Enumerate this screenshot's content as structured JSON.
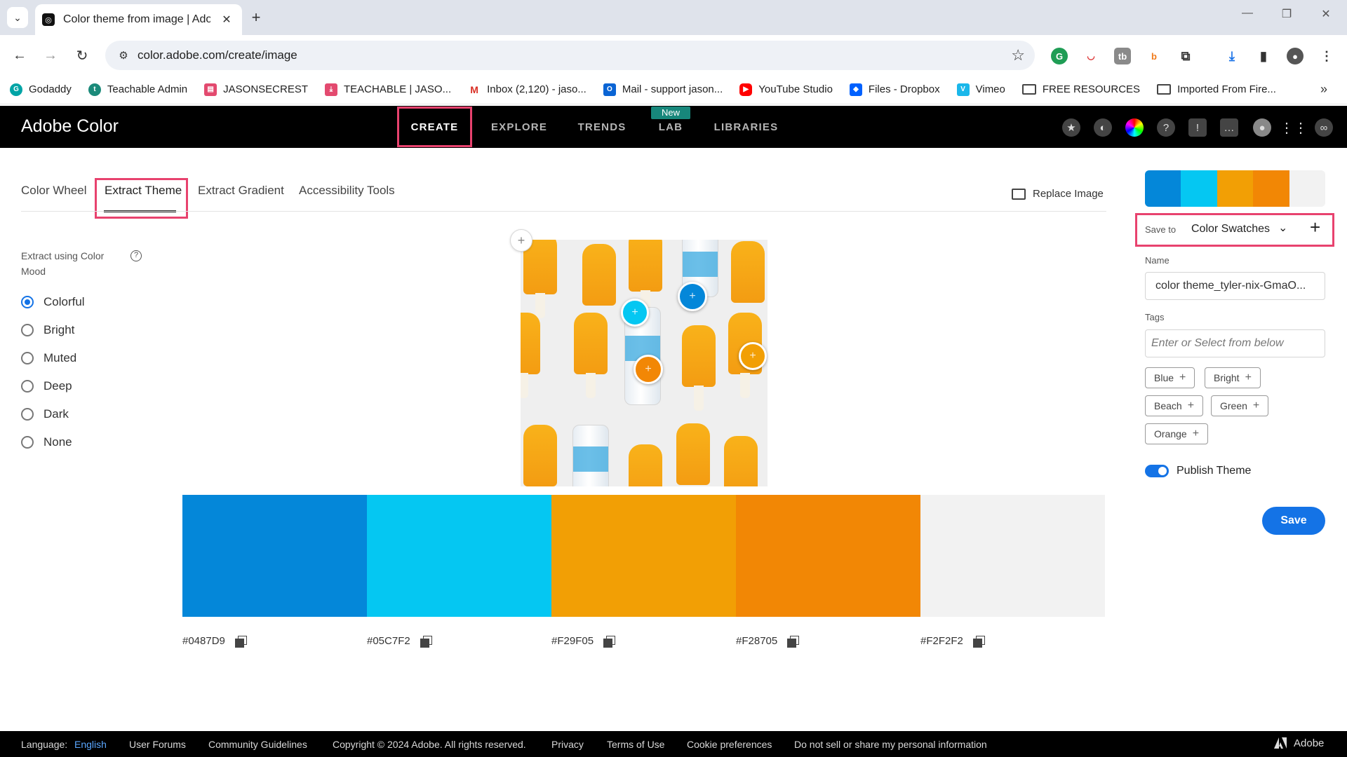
{
  "browser": {
    "tab_title": "Color theme from image | Adob",
    "url": "color.adobe.com/create/image"
  },
  "bookmarks": [
    {
      "label": "Godaddy",
      "color": "#00a4a6"
    },
    {
      "label": "Teachable Admin",
      "color": "#1b8a7a"
    },
    {
      "label": "JASONSECREST",
      "color": "#e34a6f"
    },
    {
      "label": "TEACHABLE | JASO...",
      "color": "#e34a6f"
    },
    {
      "label": "Inbox (2,120) - jaso...",
      "color": "#d93025"
    },
    {
      "label": "Mail - support jason...",
      "color": "#0a64d4"
    },
    {
      "label": "YouTube Studio",
      "color": "#ff0000"
    },
    {
      "label": "Files - Dropbox",
      "color": "#0061fe"
    },
    {
      "label": "Vimeo",
      "color": "#1ab7ea"
    },
    {
      "label": "FREE RESOURCES",
      "color": "folder"
    },
    {
      "label": "Imported From Fire...",
      "color": "folder"
    }
  ],
  "header": {
    "brand": "Adobe Color",
    "nav": [
      "CREATE",
      "EXPLORE",
      "TRENDS",
      "LAB",
      "LIBRARIES"
    ],
    "lab_badge": "New"
  },
  "subtabs": [
    "Color Wheel",
    "Extract Theme",
    "Extract Gradient",
    "Accessibility Tools"
  ],
  "replace_image": "Replace Image",
  "mood": {
    "label": "Extract using Color Mood",
    "options": [
      "Colorful",
      "Bright",
      "Muted",
      "Deep",
      "Dark",
      "None"
    ],
    "selected": "Colorful"
  },
  "palette": [
    {
      "hex": "#0487D9",
      "color": "#0487D9"
    },
    {
      "hex": "#05C7F2",
      "color": "#05C7F2"
    },
    {
      "hex": "#F29F05",
      "color": "#F29F05"
    },
    {
      "hex": "#F28705",
      "color": "#F28705"
    },
    {
      "hex": "#F2F2F2",
      "color": "#F2F2F2"
    }
  ],
  "panel": {
    "save_to_label": "Save to",
    "save_to_value": "Color Swatches",
    "name_label": "Name",
    "name_value": "color theme_tyler-nix-GmaO...",
    "tags_label": "Tags",
    "tags_placeholder": "Enter or Select from below",
    "tags": [
      "Blue",
      "Bright",
      "Beach",
      "Green",
      "Orange"
    ],
    "publish_label": "Publish Theme",
    "publish_on": true,
    "save_button": "Save"
  },
  "footer": {
    "language_label": "Language:",
    "language_value": "English",
    "links": [
      "User Forums",
      "Community Guidelines",
      "Copyright © 2024 Adobe. All rights reserved.",
      "Privacy",
      "Terms of Use",
      "Cookie preferences",
      "Do not sell or share my personal information"
    ],
    "adobe": "Adobe"
  },
  "colors": {
    "highlight": "#e8426e",
    "accent": "#1473e6"
  }
}
